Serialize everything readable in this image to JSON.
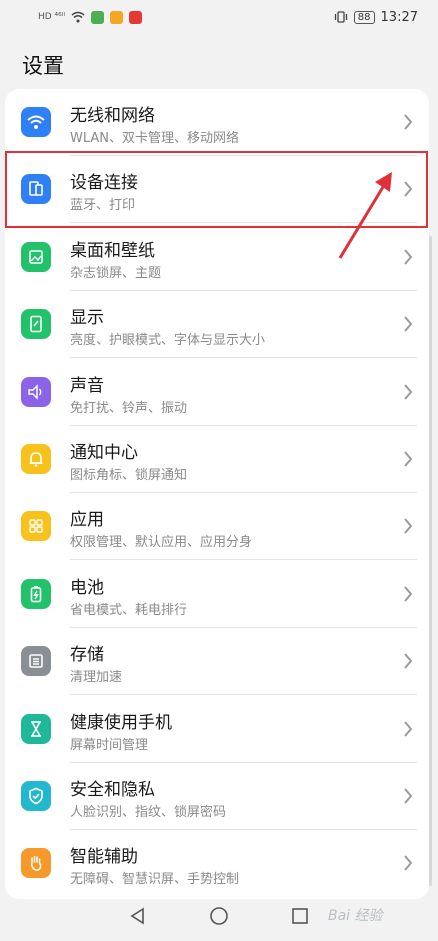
{
  "status_bar": {
    "left_text": "HD ⁴⁶ᴵˡ",
    "battery_text": "88",
    "time": "13:27"
  },
  "page": {
    "title": "设置"
  },
  "settings": [
    {
      "label": "无线和网络",
      "sub": "WLAN、双卡管理、移动网络",
      "icon": "wifi-icon",
      "color": "#2f7ff6"
    },
    {
      "label": "设备连接",
      "sub": "蓝牙、打印",
      "icon": "device-connection-icon",
      "color": "#2f7ff6"
    },
    {
      "label": "桌面和壁纸",
      "sub": "杂志锁屏、主题",
      "icon": "wallpaper-icon",
      "color": "#22c26b"
    },
    {
      "label": "显示",
      "sub": "亮度、护眼模式、字体与显示大小",
      "icon": "display-icon",
      "color": "#22c26b"
    },
    {
      "label": "声音",
      "sub": "免打扰、铃声、振动",
      "icon": "sound-icon",
      "color": "#8b63e6"
    },
    {
      "label": "通知中心",
      "sub": "图标角标、锁屏通知",
      "icon": "bell-icon",
      "color": "#f7c21c"
    },
    {
      "label": "应用",
      "sub": "权限管理、默认应用、应用分身",
      "icon": "apps-icon",
      "color": "#f7c21c"
    },
    {
      "label": "电池",
      "sub": "省电模式、耗电排行",
      "icon": "battery-icon",
      "color": "#22c26b"
    },
    {
      "label": "存储",
      "sub": "清理加速",
      "icon": "storage-icon",
      "color": "#8a8f96"
    },
    {
      "label": "健康使用手机",
      "sub": "屏幕时间管理",
      "icon": "hourglass-icon",
      "color": "#1fb89a"
    },
    {
      "label": "安全和隐私",
      "sub": "人脸识别、指纹、锁屏密码",
      "icon": "shield-icon",
      "color": "#22b8cf"
    },
    {
      "label": "智能辅助",
      "sub": "无障碍、智慧识屏、手势控制",
      "icon": "hand-icon",
      "color": "#f59a2a"
    }
  ],
  "watermark": "Bai 经验"
}
